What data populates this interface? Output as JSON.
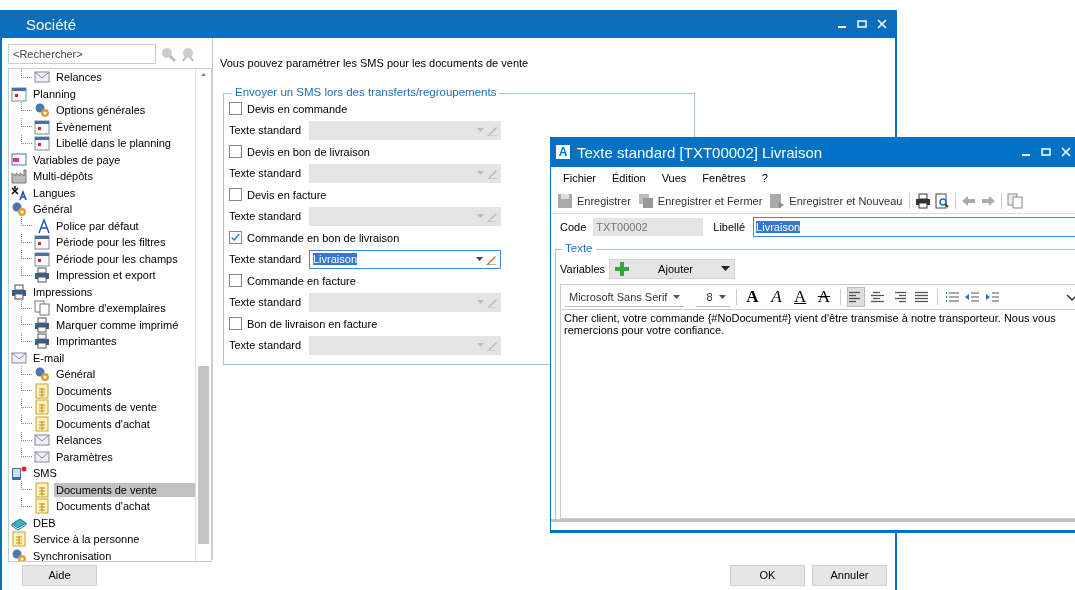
{
  "window": {
    "title": "Société"
  },
  "search": {
    "placeholder": "<Rechercher>"
  },
  "tree": [
    {
      "children": [
        {
          "label": "Relances",
          "kind": "mail",
          "selected": false
        }
      ]
    },
    {
      "label": "Planning",
      "kind": "calendar",
      "selected": false,
      "children": [
        {
          "label": "Options générales",
          "kind": "gear",
          "selected": false
        },
        {
          "label": "Évènement",
          "kind": "calendar",
          "selected": false
        },
        {
          "label": "Libellé dans le planning",
          "kind": "calendar",
          "selected": false
        }
      ]
    },
    {
      "label": "Variables de paye",
      "kind": "screen",
      "selected": false
    },
    {
      "label": "Multi-dépôts",
      "kind": "factory",
      "selected": false
    },
    {
      "label": "Langues",
      "kind": "lang",
      "selected": false
    },
    {
      "label": "Général",
      "kind": "gear",
      "selected": false,
      "children": [
        {
          "label": "Police par défaut",
          "kind": "font",
          "selected": false
        },
        {
          "label": "Période pour les filtres",
          "kind": "calendar",
          "selected": false
        },
        {
          "label": "Période pour les champs",
          "kind": "calendar",
          "selected": false
        },
        {
          "label": "Impression et export",
          "kind": "printer",
          "selected": false
        }
      ]
    },
    {
      "label": "Impressions",
      "kind": "printer",
      "selected": false,
      "children": [
        {
          "label": "Nombre d'exemplaires",
          "kind": "doc",
          "selected": false
        },
        {
          "label": "Marquer comme imprimé",
          "kind": "printer",
          "selected": false
        },
        {
          "label": "Imprimantes",
          "kind": "printer",
          "selected": false
        }
      ]
    },
    {
      "label": "E-mail",
      "kind": "mail",
      "selected": false,
      "children": [
        {
          "label": "Général",
          "kind": "gear",
          "selected": false
        },
        {
          "label": "Documents",
          "kind": "sheet",
          "selected": false
        },
        {
          "label": "Documents de vente",
          "kind": "sheet",
          "selected": false
        },
        {
          "label": "Documents d'achat",
          "kind": "sheet",
          "selected": false
        },
        {
          "label": "Relances",
          "kind": "mail",
          "selected": false
        },
        {
          "label": "Paramètres",
          "kind": "mail",
          "selected": false
        }
      ]
    },
    {
      "label": "SMS",
      "kind": "phone",
      "selected": false,
      "children": [
        {
          "label": "Documents de vente",
          "kind": "sheet",
          "selected": true
        },
        {
          "label": "Documents d'achat",
          "kind": "sheet",
          "selected": false
        }
      ]
    },
    {
      "label": "DEB",
      "kind": "book",
      "selected": false
    },
    {
      "label": "Service à la personne",
      "kind": "sheet",
      "selected": false
    },
    {
      "label": "Synchronisation",
      "kind": "gear",
      "selected": false
    }
  ],
  "intro": "Vous pouvez paramétrer les SMS pour les documents de vente",
  "group": {
    "title": "Envoyer un SMS lors des transferts/regroupements",
    "rules": [
      {
        "label": "Devis en commande",
        "checked": false,
        "field_label": "Texte standard",
        "disabled": true
      },
      {
        "label": "Devis en bon de livraison",
        "checked": false,
        "field_label": "Texte standard",
        "disabled": true
      },
      {
        "label": "Devis en facture",
        "checked": false,
        "field_label": "Texte standard",
        "disabled": true
      },
      {
        "label": "Commande en bon de livraison",
        "checked": true,
        "field_label": "Texte standard",
        "disabled": false,
        "value": "Livraison"
      },
      {
        "label": "Commande en facture",
        "checked": false,
        "field_label": "Texte standard",
        "disabled": true
      },
      {
        "label": "Bon de livraison en facture",
        "checked": false,
        "field_label": "Texte standard",
        "disabled": true
      }
    ]
  },
  "buttons": {
    "help": "Aide",
    "ok": "OK",
    "cancel": "Annuler"
  },
  "dialog": {
    "app_icon": "A",
    "title": "Texte standard [TXT00002] Livraison",
    "menu": [
      "Fichier",
      "Édition",
      "Vues",
      "Fenêtres",
      "?"
    ],
    "toolbar": [
      {
        "kind": "save",
        "label": "Enregistrer"
      },
      {
        "kind": "save-close",
        "label": "Enregistrer et Fermer"
      },
      {
        "kind": "save-new",
        "label": "Enregistrer et Nouveau"
      }
    ],
    "code": {
      "label": "Code",
      "value": "TXT00002"
    },
    "libelle": {
      "label": "Libellé",
      "value": "Livraison"
    },
    "section": "Texte",
    "variables": {
      "label": "Variables",
      "button": "Ajouter"
    },
    "font": "Microsoft Sans Serif",
    "size": "8",
    "format_buttons": [
      {
        "kind": "bold",
        "glyph": "A"
      },
      {
        "kind": "italic",
        "glyph": "A"
      },
      {
        "kind": "underline",
        "glyph": "A"
      },
      {
        "kind": "strike",
        "glyph": "A"
      }
    ],
    "align_buttons": [
      {
        "kind": "left",
        "selected": true
      },
      {
        "kind": "center",
        "selected": false
      },
      {
        "kind": "right",
        "selected": false
      },
      {
        "kind": "justify",
        "selected": false
      }
    ],
    "body": "Cher client, votre commande {#NoDocument#} vient d'être transmise à notre transporteur. Nous vous remercions pour votre confiance."
  }
}
